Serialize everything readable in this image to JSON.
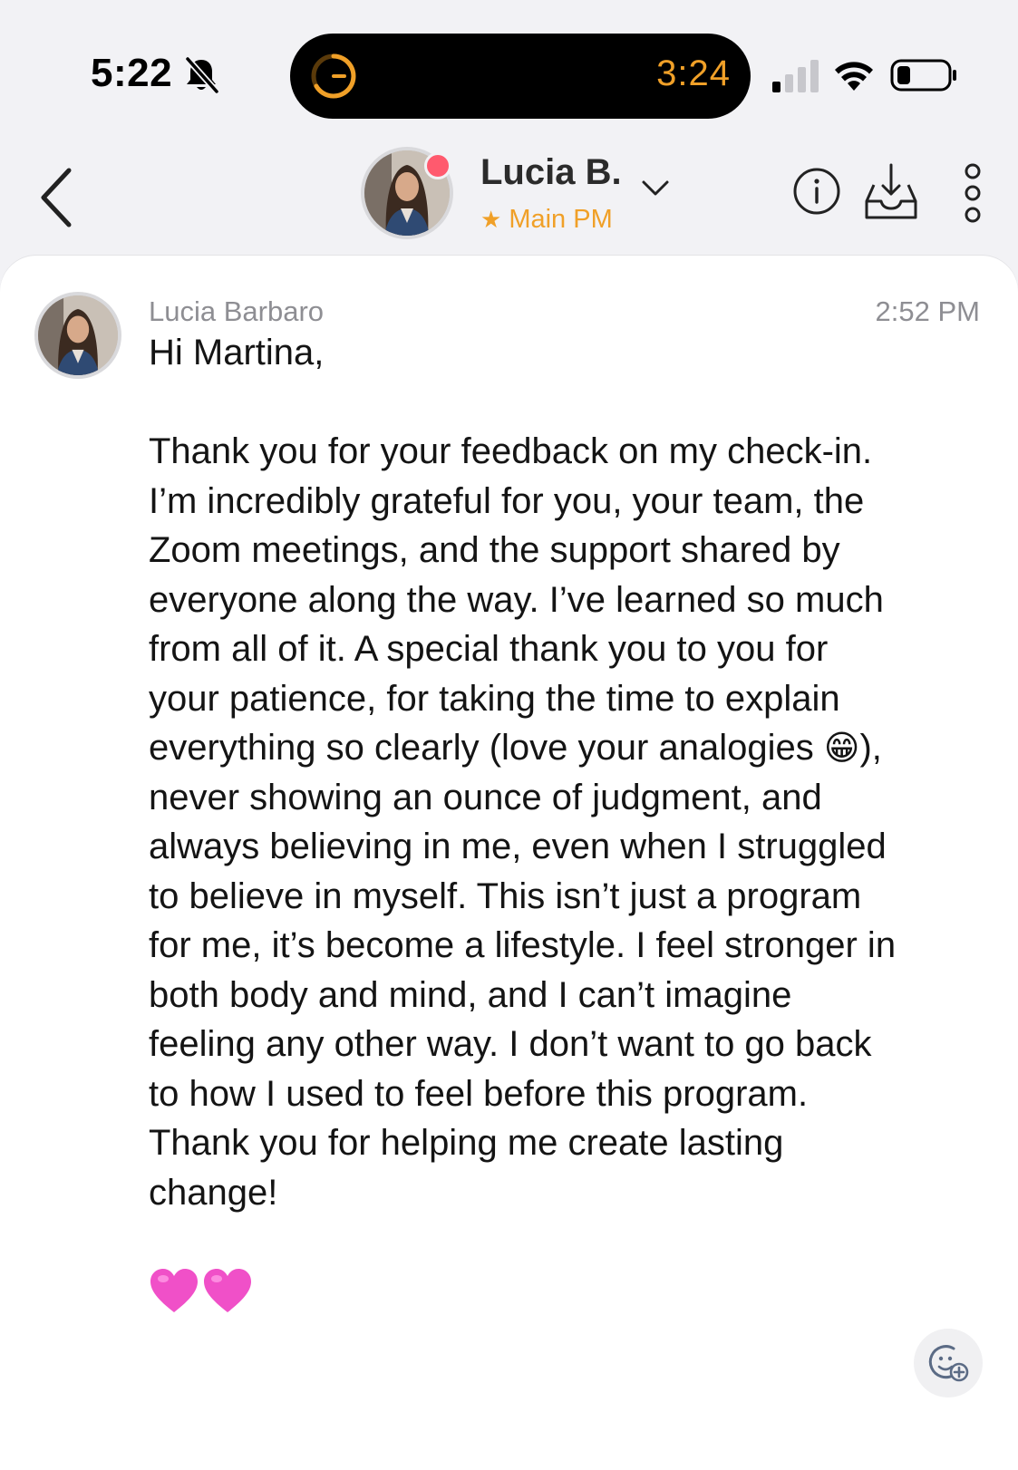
{
  "status_bar": {
    "time": "5:22",
    "island_timer": "3:24",
    "icons": [
      "bell-slash-icon",
      "timer-ring-icon",
      "cellular-signal-icon",
      "wifi-icon",
      "battery-icon"
    ]
  },
  "header": {
    "contact_name": "Lucia B.",
    "role_label": "Main PM",
    "role_star": "★",
    "online": true,
    "icons": [
      "back-chevron-icon",
      "chevron-down-icon",
      "info-icon",
      "inbox-download-icon",
      "more-vertical-icon"
    ]
  },
  "message": {
    "sender": "Lucia Barbaro",
    "time": "2:52 PM",
    "greeting": "Hi Martina,",
    "lines": [
      "Thank you for your feedback on my check-in.",
      "I’m incredibly grateful for you, your team, the",
      "Zoom meetings, and the support shared by",
      "everyone along the way. I’ve learned so much",
      "from all of it. A special thank you to you for",
      "your patience, for taking the time to explain",
      "everything so clearly (love your analogies ",
      "never showing an ounce of judgment, and",
      "always believing in me, even when I struggled",
      "to believe in myself. This isn’t just a program",
      "for me, it’s become a lifestyle. I feel stronger in",
      "both body and mind, and I can’t imagine",
      "feeling any other way. I don’t want to go back",
      "to how I used to feel before this program.",
      "Thank you for helping me create lasting",
      "change!"
    ],
    "line7_emoji": "😁",
    "line7_suffix": "),",
    "hearts": "💗💗"
  },
  "colors": {
    "accent": "#f0a028",
    "online_dot": "#ff5a6e",
    "heart": "#f050c8",
    "muted_text": "#8e8e93",
    "background": "#f2f2f5"
  }
}
